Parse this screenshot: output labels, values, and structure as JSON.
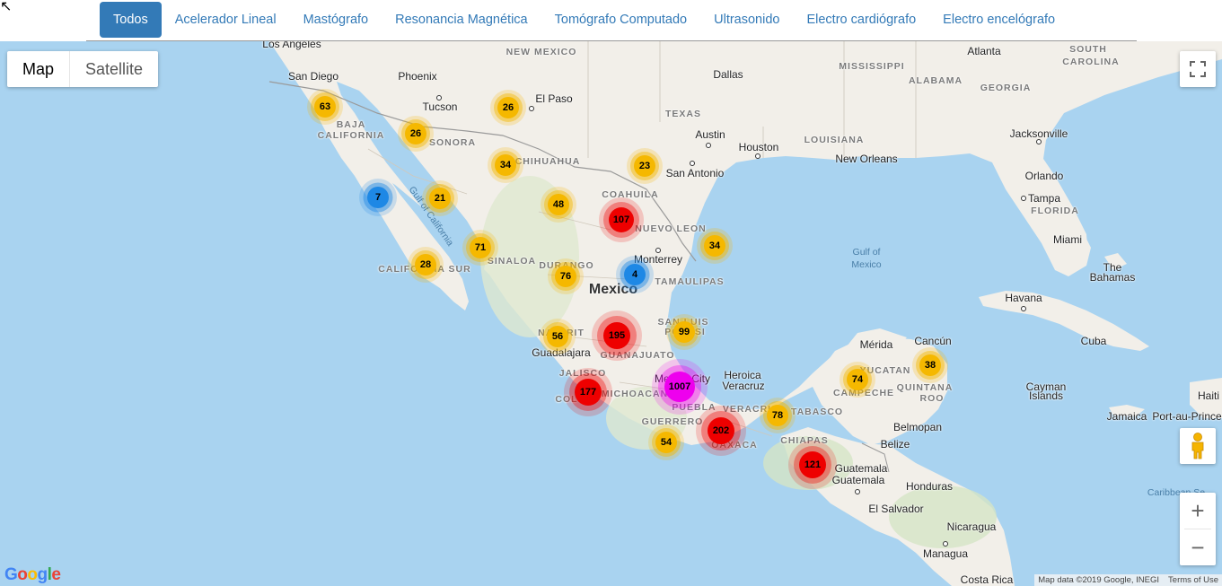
{
  "tabs": [
    {
      "label": "Todos",
      "active": true
    },
    {
      "label": "Acelerador Lineal"
    },
    {
      "label": "Mastógrafo"
    },
    {
      "label": "Resonancia Magnética"
    },
    {
      "label": "Tomógrafo Computado"
    },
    {
      "label": "Ultrasonido"
    },
    {
      "label": "Electro cardiógrafo"
    },
    {
      "label": "Electro encelógrafo"
    }
  ],
  "map_type": {
    "map": "Map",
    "satellite": "Satellite"
  },
  "zoom": {
    "in": "+",
    "out": "−"
  },
  "attribution": {
    "map_data": "Map data ©2019 Google, INEGI",
    "terms": "Terms of Use"
  },
  "logo": "Google",
  "colors": {
    "accent": "#337ab7",
    "water": "#a9d3f0",
    "land": "#f2efe9",
    "cluster_yellow": "#f5b800",
    "cluster_red": "#ee0000",
    "cluster_blue": "#1e88e5",
    "cluster_magenta": "#ee00ee"
  },
  "labels": {
    "los_angeles": "Los Angeles",
    "san_diego": "San Diego",
    "phoenix": "Phoenix",
    "tucson": "Tucson",
    "el_paso": "El Paso",
    "new_mexico": "NEW MEXICO",
    "dallas": "Dallas",
    "texas": "TEXAS",
    "austin": "Austin",
    "houston": "Houston",
    "san_antonio": "San Antonio",
    "louisiana": "LOUISIANA",
    "mississippi": "MISSISSIPPI",
    "alabama": "ALABAMA",
    "georgia": "GEORGIA",
    "atlanta": "Atlanta",
    "south_carolina": "SOUTH",
    "south_carolina2": "CAROLINA",
    "new_orleans": "New Orleans",
    "jacksonville": "Jacksonville",
    "orlando": "Orlando",
    "tampa": "Tampa",
    "florida": "FLORIDA",
    "miami": "Miami",
    "baja": "BAJA",
    "california": "CALIFORNIA",
    "sonora": "SONORA",
    "chihuahua": "CHIHUAHUA",
    "coahuila": "COAHUILA",
    "nuevo_leon": "NUEVO LEON",
    "monterrey": "Monterrey",
    "tamaulipas": "TAMAULIPAS",
    "sinaloa": "SINALOA",
    "durango": "DURANGO",
    "mexico": "Mexico",
    "california_sur": "CALIFORNIA SUR",
    "gulf_california": "Gulf of California",
    "gulf_mexico": "Gulf of",
    "gulf_mexico2": "Mexico",
    "nayarit": "NAYARIT",
    "san_luis": "SAN LUIS",
    "potosi": "POTOSI",
    "guanajuato": "GUANAJUATO",
    "guadalajara": "Guadalajara",
    "jalisco": "JALISCO",
    "michoacan": "MICHOACAN",
    "colima": "COL",
    "mexico_city": "Mexico City",
    "heroica": "Heroica",
    "veracruz": "Veracruz",
    "puebla": "PUEBLA",
    "veracruz_st": "VERACRUZ",
    "guerrero": "GUERRERO",
    "oaxaca": "OAXACA",
    "tabasco": "TABASCO",
    "chiapas": "CHIAPAS",
    "campeche": "CAMPECHE",
    "yucatan": "YUCATAN",
    "quintana": "QUINTANA",
    "roo": "ROO",
    "merida": "Mérida",
    "cancun": "Cancún",
    "belmopan": "Belmopan",
    "belize": "Belize",
    "guatemala": "Guatemala",
    "guatemala_city": "Guatemala",
    "honduras": "Honduras",
    "el_salvador": "El Salvador",
    "nicaragua": "Nicaragua",
    "managua": "Managua",
    "costa_rica": "Costa Rica",
    "havana": "Havana",
    "cuba": "Cuba",
    "cayman": "Cayman",
    "islands": "Islands",
    "jamaica": "Jamaica",
    "haiti": "Haiti",
    "port_au_prince": "Port-au-Prince",
    "bahamas_the": "The",
    "bahamas": "Bahamas",
    "caribbean": "Caribbean Se"
  },
  "clusters": [
    {
      "count": "63",
      "color": "yellow"
    },
    {
      "count": "26",
      "color": "yellow"
    },
    {
      "count": "26",
      "color": "yellow"
    },
    {
      "count": "34",
      "color": "yellow"
    },
    {
      "count": "23",
      "color": "yellow"
    },
    {
      "count": "7",
      "color": "blue"
    },
    {
      "count": "21",
      "color": "yellow"
    },
    {
      "count": "48",
      "color": "yellow"
    },
    {
      "count": "107",
      "color": "red"
    },
    {
      "count": "34",
      "color": "yellow"
    },
    {
      "count": "71",
      "color": "yellow"
    },
    {
      "count": "28",
      "color": "yellow"
    },
    {
      "count": "76",
      "color": "yellow"
    },
    {
      "count": "4",
      "color": "blue"
    },
    {
      "count": "56",
      "color": "yellow"
    },
    {
      "count": "195",
      "color": "red"
    },
    {
      "count": "99",
      "color": "yellow"
    },
    {
      "count": "74",
      "color": "yellow"
    },
    {
      "count": "38",
      "color": "yellow"
    },
    {
      "count": "177",
      "color": "red"
    },
    {
      "count": "1007",
      "color": "magenta"
    },
    {
      "count": "78",
      "color": "yellow"
    },
    {
      "count": "54",
      "color": "yellow"
    },
    {
      "count": "202",
      "color": "red"
    },
    {
      "count": "121",
      "color": "red"
    }
  ]
}
